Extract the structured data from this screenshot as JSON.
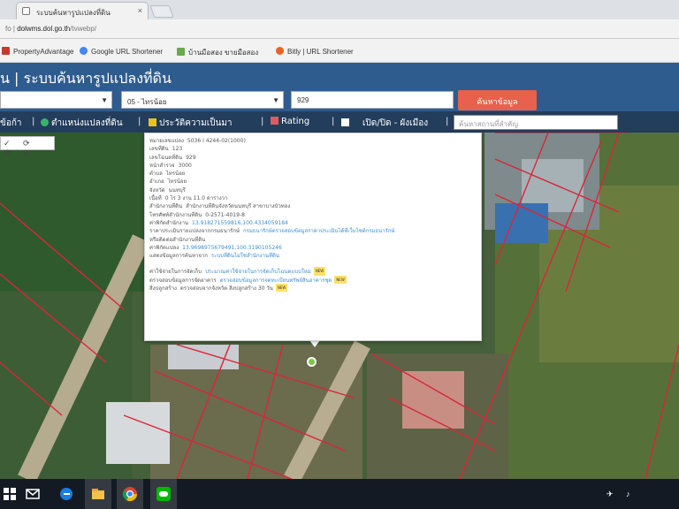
{
  "browser": {
    "tab_title": "ระบบค้นหารูปแปลงที่ดิน",
    "tab_close": "×",
    "url_info": "fo",
    "url_separator": "|",
    "url_host": "dolwms.dol.go.th",
    "url_path": "/tvwebp/",
    "bookmarks": [
      {
        "label": "PropertyAdvantage",
        "icon": "bookmark-icon",
        "color": "#c63a2c"
      },
      {
        "label": "Google URL Shortener",
        "icon": "google-icon",
        "color": "#4285f4"
      },
      {
        "label": "บ้านมือสอง ขายมือสอง",
        "icon": "house-icon",
        "color": "#6aa84f"
      },
      {
        "label": "Bitly | URL Shortener",
        "icon": "bitly-icon",
        "color": "#ee6123"
      }
    ]
  },
  "app": {
    "title": "น | ระบบค้นหารูปแปลงที่ดิน",
    "province_select": "",
    "district_select": "05 - ไทรน้อย",
    "parcel_input": "929",
    "search_button": "ค้นหาข้อมูล",
    "toolbar": [
      {
        "label": "ข้อก้า",
        "icon": "",
        "sep_after": "|"
      },
      {
        "label": "ตำแหน่งแปลงที่ดิน",
        "icon": "location-icon",
        "sep_after": "|"
      },
      {
        "label": "ประวัติความเป็นมา",
        "icon": "history-icon",
        "sep_after": "|"
      },
      {
        "label": "Rating",
        "icon": "rating-icon",
        "sep_after": "|"
      },
      {
        "label": "เปิด/ปิด - ผังเมือง",
        "icon": "checkbox-icon",
        "sep_after": "|"
      }
    ],
    "address_placeholder": "ค้นหาสถานที่สำคัญ"
  },
  "map": {
    "controls": "✓ ⟳ ⚙ ⊞"
  },
  "popup": {
    "rows": [
      {
        "k": "หมายเลขแปลง",
        "v": "5036 I 4244-02(1000)",
        "link": false
      },
      {
        "k": "เลขที่ดิน",
        "v": "123",
        "link": false
      },
      {
        "k": "เลขโฉนดที่ดิน",
        "v": "929",
        "link": false
      },
      {
        "k": "หน้าสำรวจ",
        "v": "3000",
        "link": false
      },
      {
        "k": "ตำบล",
        "v": "ไทรน้อย",
        "link": false
      },
      {
        "k": "อำเภอ",
        "v": "ไทรน้อย",
        "link": false
      },
      {
        "k": "จังหวัด",
        "v": "นนทบุรี",
        "link": false
      },
      {
        "k": "เนื้อที่",
        "v": "0 ไร่ 3 งาน 11.0 ตารางวา",
        "link": false
      },
      {
        "k": "สำนักงานที่ดิน",
        "v": "สำนักงานที่ดินจังหวัดนนทบุรี สาขาบางบัวทอง",
        "link": false
      },
      {
        "k": "โทรศัพท์สำนักงานที่ดิน",
        "v": "0-2571-4019-8",
        "link": false
      },
      {
        "k": "ค่าพิกัดสำนักงาน",
        "v": "13.918271559816,100.4334059184",
        "link": true
      },
      {
        "k": "ราคาประเมินรายแปลงจากกรมธนารักษ์",
        "v": "กรมธนารักษ์ตรวจสอบข้อมูลราคาประเมินได้ที่เว็บไซต์กรมธนารักษ์",
        "link": true
      },
      {
        "k": "หรือติดต่อสำนักงานที่ดิน",
        "v": "",
        "link": false
      },
      {
        "k": "ค่าพิกัดแปลง",
        "v": "13.9698975679491,100.3190105246",
        "link": true
      },
      {
        "k": "แสดงข้อมูลการค้นหาจาก",
        "v": "ระบบที่ดินไม่ใช่สำนักงานที่ดิน",
        "link": true
      }
    ],
    "rows2": [
      {
        "k": "ค่าใช้จ่ายในการจัดเก็บ",
        "v": "ประมาณค่าใช้จ่ายในการจัดเก็บโฉนดแบบใหม่",
        "link": true,
        "tag": "NEW"
      },
      {
        "k": "ตรวจสอบข้อมูลการจัดอาคาร",
        "v": "ตรวจสอบข้อมูลการจดทะเบียนทรัพย์สินอาคารชุด",
        "link": true,
        "tag": "NEW"
      },
      {
        "k": "สิ่งปลูกสร้าง",
        "v": "ตรวจสอบจากจังหวัด สิ่งปลูกสร้าง 30 วัน",
        "link": false,
        "tag": "NEW"
      }
    ]
  },
  "colors": {
    "header": "#2e5c8f",
    "toolbar": "#233d5c",
    "search_button": "#e8614c",
    "link": "#3c8ed3",
    "map_parcel_line": "#d9263a",
    "taskbar": "#141a24"
  },
  "taskbar": {
    "icons": [
      "windows-icon",
      "search-icon",
      "mail-icon",
      "edge-icon",
      "file-explorer-icon",
      "chrome-icon",
      "line-icon"
    ],
    "tray": [
      "network-icon",
      "volume-icon"
    ]
  }
}
